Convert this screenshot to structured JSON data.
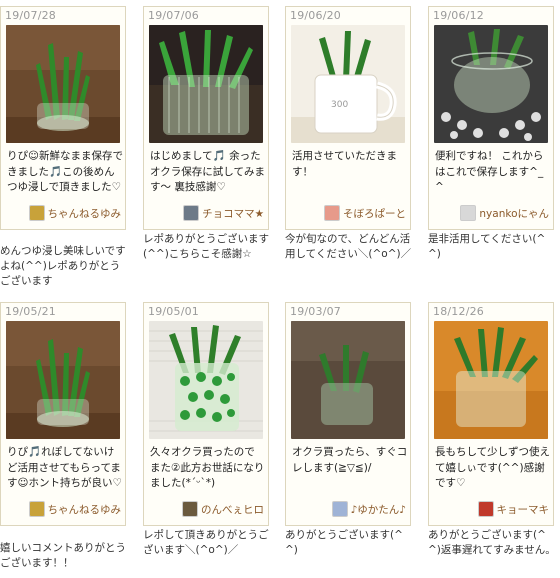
{
  "reports": [
    {
      "date": "19/07/28",
      "comment": "りぴ☺新鮮なまま保存できました🎵この後めんつゆ浸しで頂きました♡",
      "username": "ちゃんねるゆみ",
      "reply": "めんつゆ浸し美味しいですよね(^^)レポありがとうございます",
      "photo": "okra-short-glass-brown",
      "avatar_color": "#c8a23a"
    },
    {
      "date": "19/07/06",
      "comment": "はじめまして🎵 余ったオクラ保存に試してみます〜 裏技感謝♡",
      "username": "チョコママ★",
      "reply": "レポありがとうございます(^^)こちらこそ感謝☆",
      "photo": "okra-ribbed-glass",
      "avatar_color": "#6d7a88"
    },
    {
      "date": "19/06/20",
      "comment": "活用させていただきます！",
      "username": "そぼろぱーと",
      "reply": "今が旬なので、どんどん活用してください＼(^o^)／",
      "photo": "okra-white-mug",
      "avatar_color": "#e79a8a"
    },
    {
      "date": "19/06/12",
      "comment": "便利ですね！ これからはこれで保存します^_^",
      "username": "nyankoにゃん",
      "reply": "是非活用してください(^^)",
      "photo": "okra-glass-lace",
      "avatar_color": "#d8d8d8"
    },
    {
      "date": "19/05/21",
      "comment": "りぴ🎵れぽしてないけど活用させてもらってます☺ホント持ちが良い♡",
      "username": "ちゃんねるゆみ",
      "reply": "嬉しいコメントありがとうございます！！",
      "photo": "okra-short-glass-brown",
      "avatar_color": "#c8a23a"
    },
    {
      "date": "19/05/01",
      "comment": "久々オクラ買ったので また②此方お世話になりました(*ˊᵕˋ*)",
      "username": "のんべぇヒロ",
      "reply": "レポして頂きありがとうございます＼(^o^)／",
      "photo": "okra-polka-glass",
      "avatar_color": "#6b5a3e"
    },
    {
      "date": "19/03/07",
      "comment": "オクラ買ったら、すぐコレします(≧▽≦)/",
      "username": "♪ゆかたん♪",
      "reply": "ありがとうございます(^^)",
      "photo": "okra-small-glass-dark",
      "avatar_color": "#9fb3d6"
    },
    {
      "date": "18/12/26",
      "comment": "長もちして少しずつ使えて嬉しぃです(^^)感謝です♡",
      "username": "キョーマキ",
      "reply": "ありがとうございます(^^)返事遅れてすみません。",
      "photo": "okra-glass-orange",
      "avatar_color": "#c0392b"
    }
  ]
}
